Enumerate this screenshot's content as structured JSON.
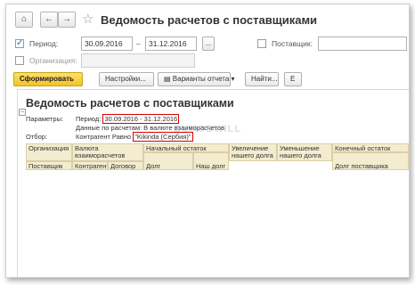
{
  "window": {
    "title": "Ведомость расчетов с поставщиками",
    "home_icon": "home-icon",
    "back_icon": "arrow-left-icon",
    "forward_icon": "arrow-right-icon",
    "favorite_icon": "star-icon"
  },
  "filters": {
    "period_checked": true,
    "period_label": "Период:",
    "period_from": "30.09.2016",
    "period_dash": "–",
    "period_to": "31.12.2016",
    "period_picker": "...",
    "supplier_checked": false,
    "supplier_label": "Поставщик:",
    "supplier_value": "",
    "organization_checked": false,
    "organization_label": "Организация:",
    "organization_value": ""
  },
  "toolbar": {
    "generate": "Сформировать",
    "settings": "Настройки...",
    "variants": "Варианты отчета",
    "find": "Найти...",
    "more": "Е"
  },
  "report": {
    "title": "Ведомость расчетов с поставщиками",
    "params_label": "Параметры:",
    "period_text": "Период:",
    "period_value": "30.09.2016 - 31.12.2016",
    "data_line": "Данные по расчетам: В валюте взаиморасчетов",
    "filter_label": "Отбор:",
    "filter_text": "Контрагент Равно",
    "filter_value": "\"Kikinda (Сербия)\"",
    "watermark": "BUHODWILL"
  },
  "table": {
    "header_row1": [
      "Организация",
      "Валюта взаиморасчетов",
      "Начальный остаток",
      "Увеличение нашего долга",
      "Уменьшение нашего долга",
      "Конечный остаток"
    ],
    "header_row2": [
      "Поставщик",
      "Контрагент",
      "Договор",
      "Долг поставщика",
      "Наш долг",
      "Долг поставщика"
    ]
  },
  "colors": {
    "primary_button": "#f2c424",
    "highlight_box": "#d40000",
    "table_header": "#f3eccf"
  }
}
